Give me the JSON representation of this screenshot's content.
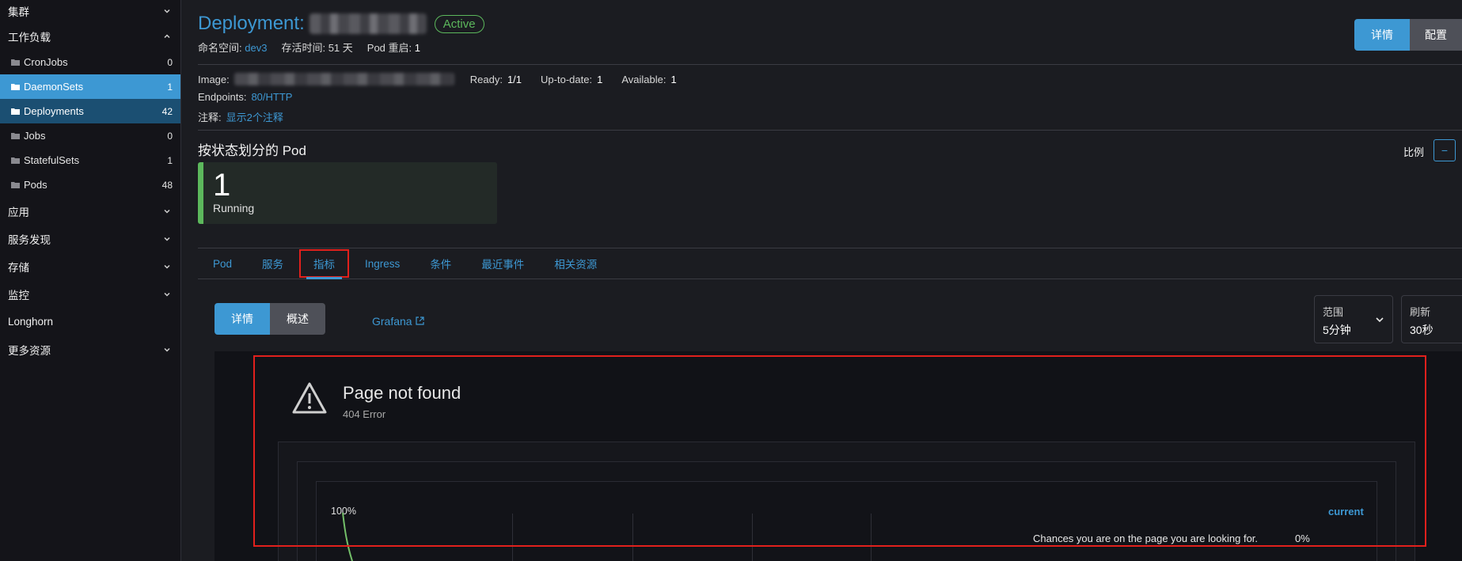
{
  "sidebar": {
    "cluster": "集群",
    "workloads": "工作负载",
    "items": [
      {
        "label": "CronJobs",
        "count": "0"
      },
      {
        "label": "DaemonSets",
        "count": "1"
      },
      {
        "label": "Deployments",
        "count": "42"
      },
      {
        "label": "Jobs",
        "count": "0"
      },
      {
        "label": "StatefulSets",
        "count": "1"
      },
      {
        "label": "Pods",
        "count": "48"
      }
    ],
    "apps": "应用",
    "service_discovery": "服务发现",
    "storage": "存储",
    "monitoring": "监控",
    "longhorn": "Longhorn",
    "more_resources": "更多资源"
  },
  "header": {
    "kind": "Deployment:",
    "status": "Active",
    "namespace_label": "命名空间:",
    "namespace_value": "dev3",
    "age_label": "存活时间:",
    "age_value": "51 天",
    "restarts_label": "Pod 重启:",
    "restarts_value": "1",
    "btn_detail": "详情",
    "btn_config": "配置"
  },
  "info": {
    "image_label": "Image:",
    "ready_label": "Ready:",
    "ready_value": "1/1",
    "uptodate_label": "Up-to-date:",
    "uptodate_value": "1",
    "available_label": "Available:",
    "available_value": "1",
    "endpoints_label": "Endpoints:",
    "endpoints_value": "80/HTTP",
    "notes_label": "注释:",
    "notes_value": "显示2个注释"
  },
  "pods_by_state": {
    "title": "按状态划分的 Pod",
    "scale_label": "比例",
    "scale_button": "−",
    "count": "1",
    "state": "Running"
  },
  "tabs": [
    "Pod",
    "服务",
    "指标",
    "Ingress",
    "条件",
    "最近事件",
    "相关资源"
  ],
  "metrics": {
    "seg_detail": "详情",
    "seg_overview": "概述",
    "grafana": "Grafana",
    "range_label": "范围",
    "range_value": "5分钟",
    "refresh_label": "刷新",
    "refresh_value": "30秒"
  },
  "embed": {
    "title": "Page not found",
    "subtitle": "404 Error",
    "axis_100": "100%",
    "current": "current",
    "chances_text": "Chances you are on the page you are looking for.",
    "chances_value": "0%"
  },
  "colors": {
    "accent": "#3d98d3",
    "active_green": "#5cb85c",
    "highlight_red": "#e1201c"
  }
}
